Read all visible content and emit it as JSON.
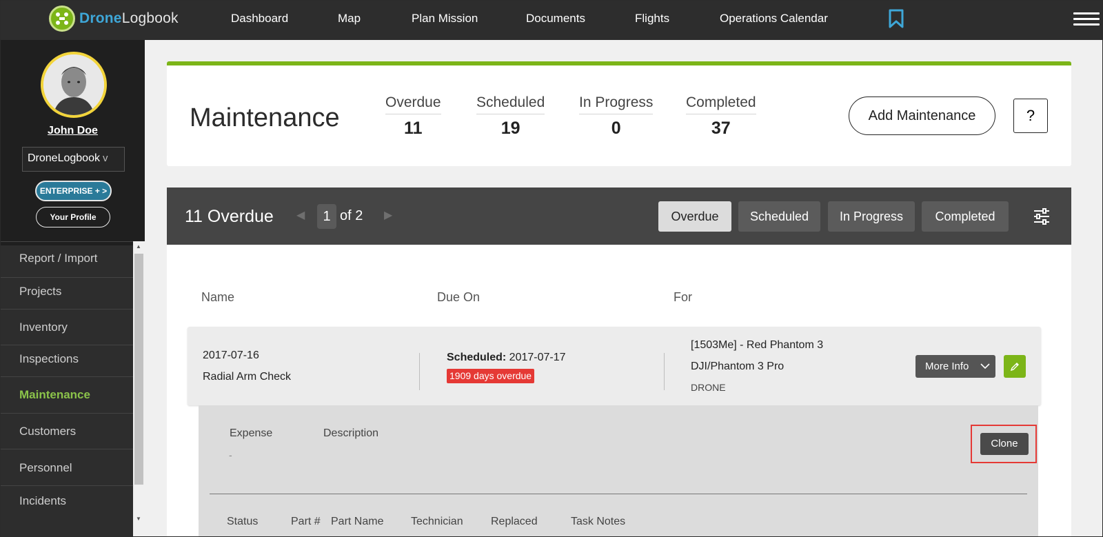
{
  "app": {
    "logo_bold": "Drone",
    "logo_rest": "Logbook"
  },
  "nav": {
    "items": [
      "Dashboard",
      "Map",
      "Plan Mission",
      "Documents",
      "Flights",
      "Operations Calendar"
    ]
  },
  "profile": {
    "name": "John Doe",
    "org": "DroneLogbook",
    "org_chevron": "v",
    "enterprise_label": "ENTERPRISE + >",
    "profile_label": "Your Profile"
  },
  "sidebar": {
    "items": [
      {
        "label": "Report / Import"
      },
      {
        "label": "Projects"
      },
      {
        "label": "Inventory"
      },
      {
        "label": "Inspections"
      },
      {
        "label": "Maintenance",
        "active": true
      },
      {
        "label": "Customers"
      },
      {
        "label": "Personnel"
      },
      {
        "label": "Incidents"
      }
    ]
  },
  "header": {
    "title": "Maintenance",
    "stats": [
      {
        "label": "Overdue",
        "value": "11"
      },
      {
        "label": "Scheduled",
        "value": "19"
      },
      {
        "label": "In Progress",
        "value": "0"
      },
      {
        "label": "Completed",
        "value": "37"
      }
    ],
    "add_label": "Add Maintenance",
    "help_label": "?"
  },
  "list": {
    "title": "11 Overdue",
    "page": "1",
    "page_of": "of 2",
    "filters": [
      {
        "label": "Overdue",
        "active": true
      },
      {
        "label": "Scheduled"
      },
      {
        "label": "In Progress"
      },
      {
        "label": "Completed"
      }
    ],
    "columns": [
      "Name",
      "Due On",
      "For"
    ]
  },
  "row": {
    "date": "2017-07-16",
    "name": "Radial Arm Check",
    "scheduled_label": "Scheduled:",
    "scheduled_date": " 2017-07-17",
    "overdue_badge": "1909 days overdue",
    "for_line1": "[1503Me] - Red Phantom 3",
    "for_line2": "DJI/Phantom 3 Pro",
    "for_line3": "DRONE",
    "more_info_label": "More Info"
  },
  "detail": {
    "expense_label": "Expense",
    "expense_value": "-",
    "description_label": "Description",
    "clone_label": "Clone",
    "subcolumns": [
      "Status",
      "Part #",
      "Part Name",
      "Technician",
      "Replaced",
      "Task Notes"
    ]
  },
  "colors": {
    "accent_green": "#7cb518",
    "overdue_red": "#e53935",
    "enterprise_blue": "#2a7a99",
    "bookmark_blue": "#3ea7d8"
  }
}
